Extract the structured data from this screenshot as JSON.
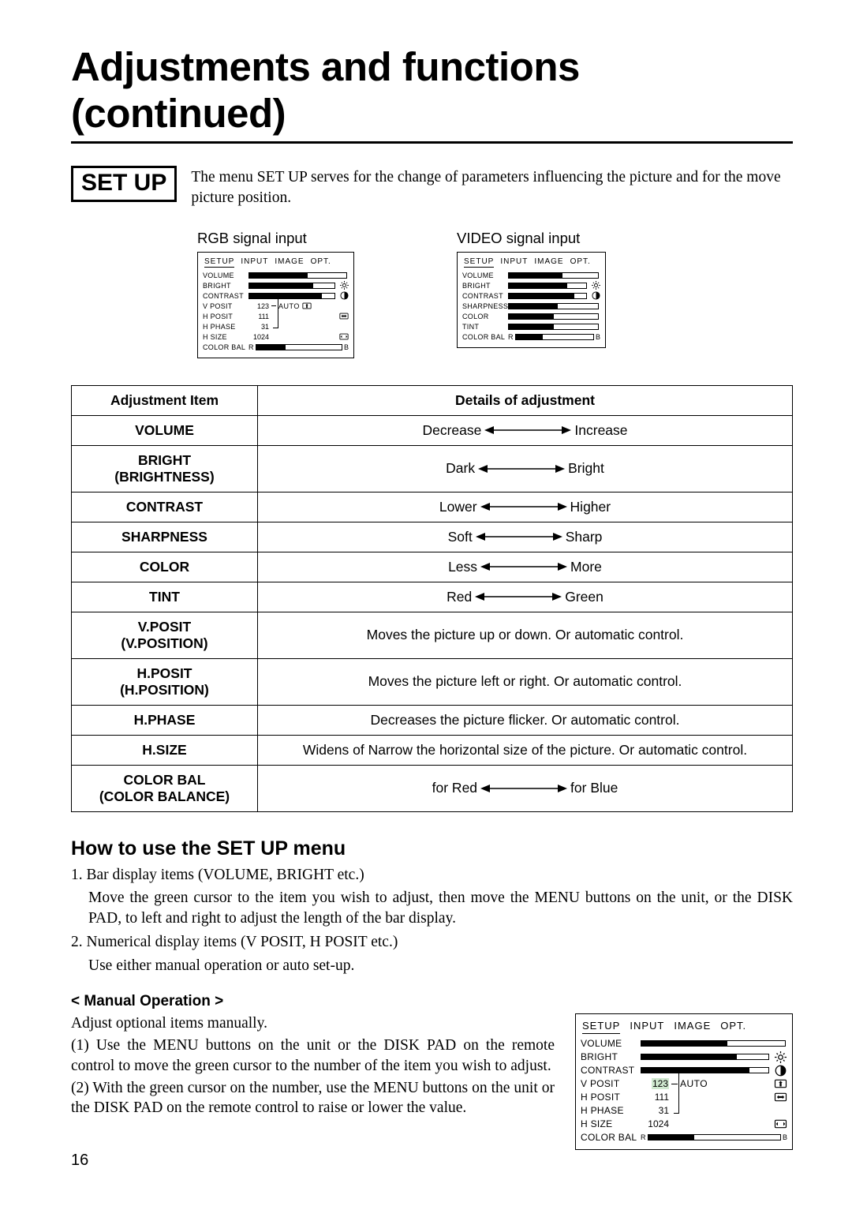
{
  "page_title": "Adjustments and functions (continued)",
  "setup_box": "SET UP",
  "intro": "The menu SET UP serves for the change of parameters influencing the picture and for the move picture position.",
  "osd_rgb_label": "RGB signal input",
  "osd_video_label": "VIDEO signal input",
  "osd_tabs": {
    "setup": "SETUP",
    "input": "INPUT",
    "image": "IMAGE",
    "opt": "OPT."
  },
  "osd_auto": "AUTO",
  "osd_r": "R",
  "osd_b": "B",
  "rgb_items": {
    "volume": "VOLUME",
    "bright": "BRIGHT",
    "contrast": "CONTRAST",
    "vposit": "V POSIT",
    "hposit": "H POSIT",
    "hphase": "H PHASE",
    "hsize": "H SIZE",
    "colorbal": "COLOR BAL"
  },
  "rgb_values": {
    "vposit": "123",
    "hposit": "111",
    "hphase": "31",
    "hsize": "1024"
  },
  "video_items": {
    "volume": "VOLUME",
    "bright": "BRIGHT",
    "contrast": "CONTRAST",
    "sharpness": "SHARPNESS",
    "color": "COLOR",
    "tint": "TINT",
    "colorbal": "COLOR BAL"
  },
  "table": {
    "head_item": "Adjustment Item",
    "head_detail": "Details of adjustment",
    "rows": [
      {
        "item": "VOLUME",
        "left": "Decrease",
        "right": "Increase",
        "type": "lr"
      },
      {
        "item": "BRIGHT\n(BRIGHTNESS)",
        "left": "Dark",
        "right": "Bright",
        "type": "lr"
      },
      {
        "item": "CONTRAST",
        "left": "Lower",
        "right": "Higher",
        "type": "lr"
      },
      {
        "item": "SHARPNESS",
        "left": "Soft",
        "right": "Sharp",
        "type": "lr"
      },
      {
        "item": "COLOR",
        "left": "Less",
        "right": "More",
        "type": "lr"
      },
      {
        "item": "TINT",
        "left": "Red",
        "right": "Green",
        "type": "lr"
      },
      {
        "item": "V.POSIT\n(V.POSITION)",
        "text": "Moves the picture up or down. Or automatic control.",
        "type": "text"
      },
      {
        "item": "H.POSIT\n(H.POSITION)",
        "text": "Moves the picture left or right. Or automatic control.",
        "type": "text"
      },
      {
        "item": "H.PHASE",
        "text": "Decreases the picture flicker. Or automatic control.",
        "type": "text"
      },
      {
        "item": "H.SIZE",
        "text": "Widens of Narrow the horizontal size of the picture. Or automatic control.",
        "type": "text"
      },
      {
        "item": "COLOR BAL\n(COLOR BALANCE)",
        "left": "for Red",
        "right": "for Blue",
        "type": "lr"
      }
    ]
  },
  "howto_head": "How to use the SET UP menu",
  "howto": {
    "n1": "1. Bar display items (VOLUME, BRIGHT etc.)",
    "n1b": "Move the green cursor to the item you wish to adjust, then move the MENU buttons on the unit, or the DISK PAD, to left and right to adjust the length of the bar display.",
    "n2": "2. Numerical display items (V POSIT, H POSIT etc.)",
    "n2b": "Use either manual operation or auto set-up."
  },
  "manual_head": "< Manual Operation >",
  "manual": {
    "lead": "Adjust optional items manually.",
    "p1": "(1) Use the MENU buttons on the unit or the DISK PAD on the remote control to move the green cursor to the number of the item you wish to adjust.",
    "p2": "(2) With the green cursor on the number, use the MENU buttons on the unit or the DISK PAD on the remote control to raise or lower the value."
  },
  "page_number": "16"
}
